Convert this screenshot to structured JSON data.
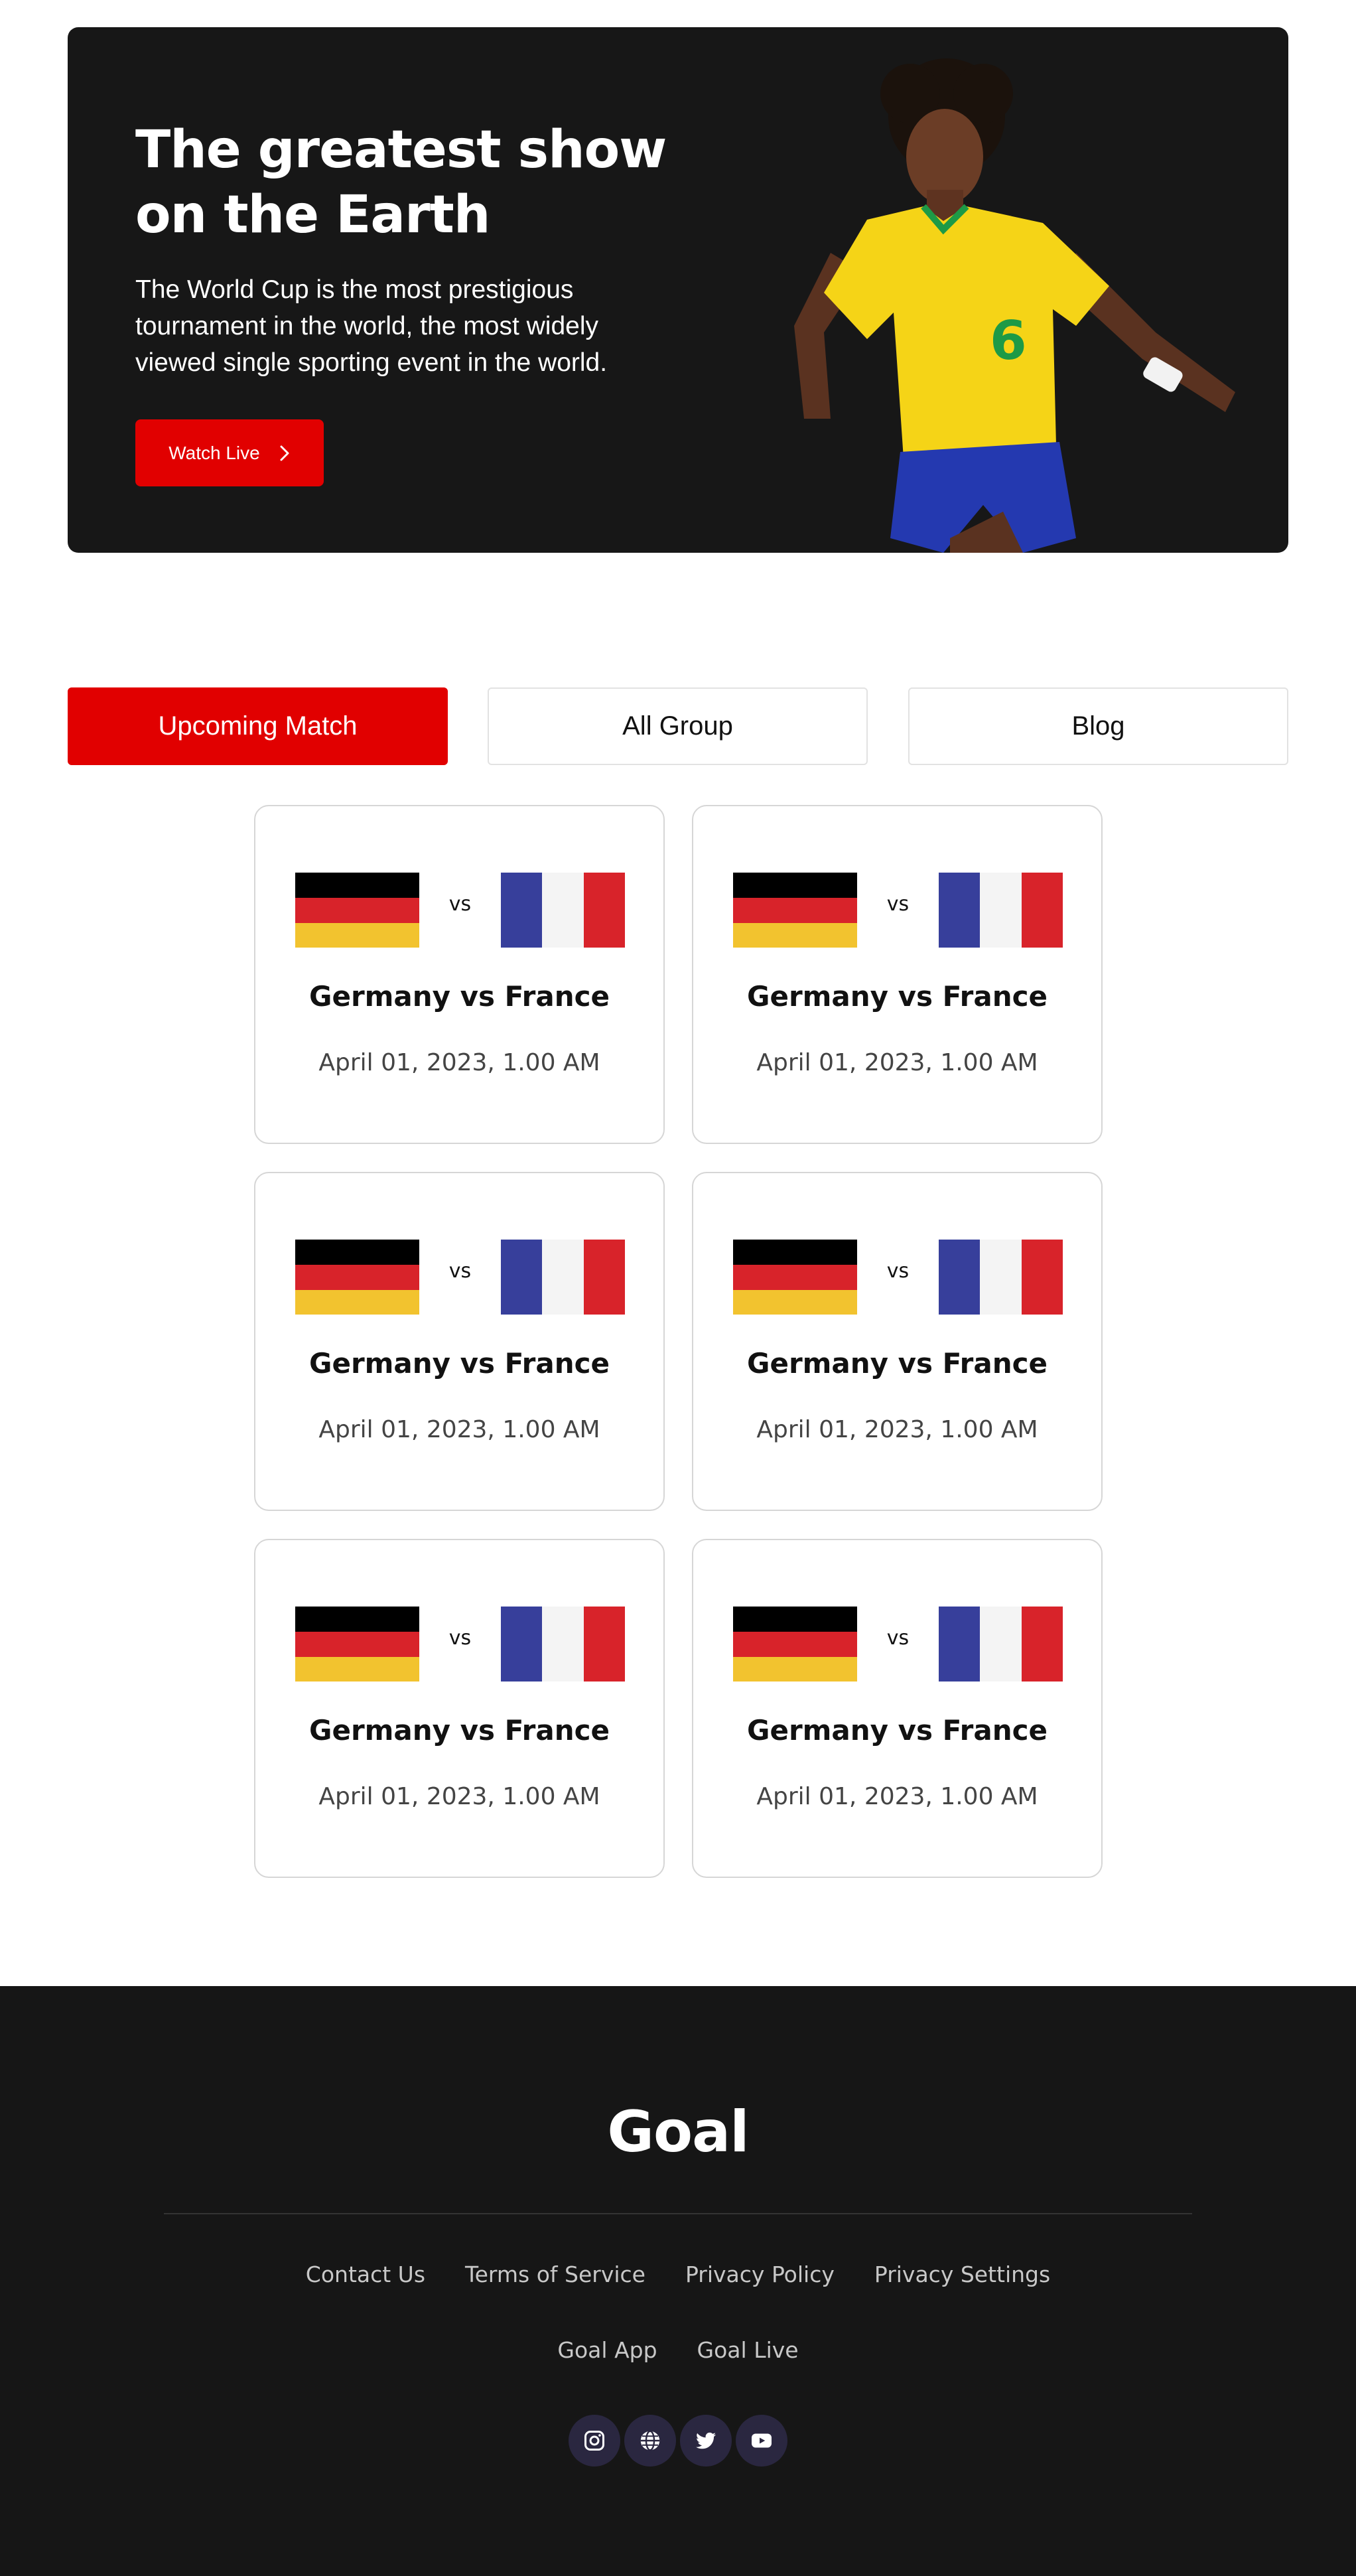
{
  "hero": {
    "title": "The greatest show on the Earth",
    "description": "The World Cup is the most prestigious tournament in the world, the most widely viewed single sporting event in the world.",
    "cta_label": "Watch Live",
    "cta_icon": "chevron-right-icon",
    "image": "soccer-player-yellow-jersey-number-6"
  },
  "tabs": [
    {
      "label": "Upcoming Match",
      "active": true
    },
    {
      "label": "All Group",
      "active": false
    },
    {
      "label": "Blog",
      "active": false
    }
  ],
  "matches": [
    {
      "home_flag": "germany-flag",
      "away_flag": "france-flag",
      "vs": "vs",
      "title": "Germany vs France",
      "date": "April 01, 2023, 1.00 AM"
    },
    {
      "home_flag": "germany-flag",
      "away_flag": "france-flag",
      "vs": "vs",
      "title": "Germany vs France",
      "date": "April 01, 2023, 1.00 AM"
    },
    {
      "home_flag": "germany-flag",
      "away_flag": "france-flag",
      "vs": "vs",
      "title": "Germany vs France",
      "date": "April 01, 2023, 1.00 AM"
    },
    {
      "home_flag": "germany-flag",
      "away_flag": "france-flag",
      "vs": "vs",
      "title": "Germany vs France",
      "date": "April 01, 2023, 1.00 AM"
    },
    {
      "home_flag": "germany-flag",
      "away_flag": "france-flag",
      "vs": "vs",
      "title": "Germany vs France",
      "date": "April 01, 2023, 1.00 AM"
    },
    {
      "home_flag": "germany-flag",
      "away_flag": "france-flag",
      "vs": "vs",
      "title": "Germany vs France",
      "date": "April 01, 2023, 1.00 AM"
    }
  ],
  "footer": {
    "logo": "Goal",
    "links_row1": [
      "Contact Us",
      "Terms of Service",
      "Privacy Policy",
      "Privacy Settings"
    ],
    "links_row2": [
      "Goal App",
      "Goal Live"
    ],
    "socials": [
      "instagram-icon",
      "globe-icon",
      "twitter-icon",
      "youtube-icon"
    ]
  },
  "colors": {
    "accent": "#e10000",
    "dark_bg": "#171717",
    "footer_bg": "#161616",
    "social_bg": "#2a2740",
    "germany": [
      "#000000",
      "#d8232a",
      "#f2c32f"
    ],
    "france": [
      "#373f9b",
      "#f4f4f4",
      "#d8232a"
    ]
  }
}
